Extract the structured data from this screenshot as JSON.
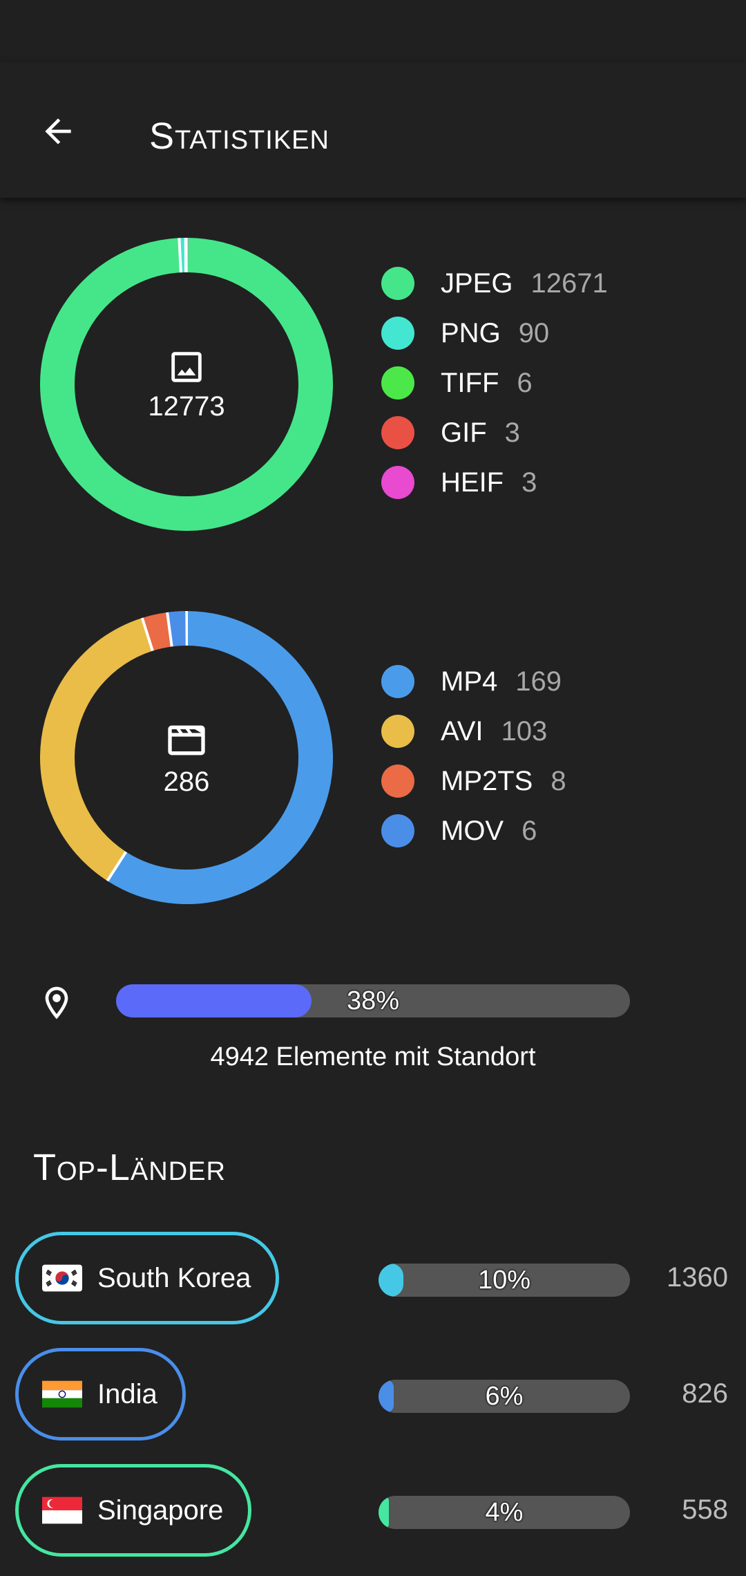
{
  "header": {
    "title": "Statistiken",
    "back_icon": "arrow-back-icon"
  },
  "images": {
    "icon": "image-icon",
    "total": "12773",
    "chart_data": {
      "type": "pie",
      "categories": [
        "JPEG",
        "PNG",
        "TIFF",
        "GIF",
        "HEIF"
      ],
      "values": [
        12671,
        90,
        6,
        3,
        3
      ],
      "colors": [
        "#45e68a",
        "#43e6d0",
        "#4ce84a",
        "#ea5145",
        "#e84ad0"
      ]
    },
    "legend": [
      {
        "label": "JPEG",
        "count": "12671",
        "color": "#45e68a"
      },
      {
        "label": "PNG",
        "count": "90",
        "color": "#43e6d0"
      },
      {
        "label": "TIFF",
        "count": "6",
        "color": "#4ce84a"
      },
      {
        "label": "GIF",
        "count": "3",
        "color": "#ea5145"
      },
      {
        "label": "HEIF",
        "count": "3",
        "color": "#e84ad0"
      }
    ]
  },
  "videos": {
    "icon": "movie-icon",
    "total": "286",
    "chart_data": {
      "type": "pie",
      "categories": [
        "MP4",
        "AVI",
        "MP2TS",
        "MOV"
      ],
      "values": [
        169,
        103,
        8,
        6
      ],
      "colors": [
        "#4a9ceb",
        "#e9bd48",
        "#ea6b45",
        "#4a8ee8"
      ]
    },
    "legend": [
      {
        "label": "MP4",
        "count": "169",
        "color": "#4a9ceb"
      },
      {
        "label": "AVI",
        "count": "103",
        "color": "#e9bd48"
      },
      {
        "label": "MP2TS",
        "count": "8",
        "color": "#ea6b45"
      },
      {
        "label": "MOV",
        "count": "6",
        "color": "#4a8ee8"
      }
    ]
  },
  "location": {
    "icon": "location-pin-icon",
    "percent_label": "38%",
    "fraction": 0.38,
    "bar_color": "#5b6af8",
    "caption": "4942 Elemente mit Standort"
  },
  "countries": {
    "title": "Top-Länder",
    "items": [
      {
        "name": "South Korea",
        "percent_label": "10%",
        "fraction": 0.1,
        "count": "1360",
        "color": "#45c8e6",
        "flag_icon": "flag-south-korea-icon"
      },
      {
        "name": "India",
        "percent_label": "6%",
        "fraction": 0.06,
        "count": "826",
        "color": "#4a8ee8",
        "flag_icon": "flag-india-icon"
      },
      {
        "name": "Singapore",
        "percent_label": "4%",
        "fraction": 0.04,
        "count": "558",
        "color": "#45e6a0",
        "flag_icon": "flag-singapore-icon"
      }
    ]
  }
}
